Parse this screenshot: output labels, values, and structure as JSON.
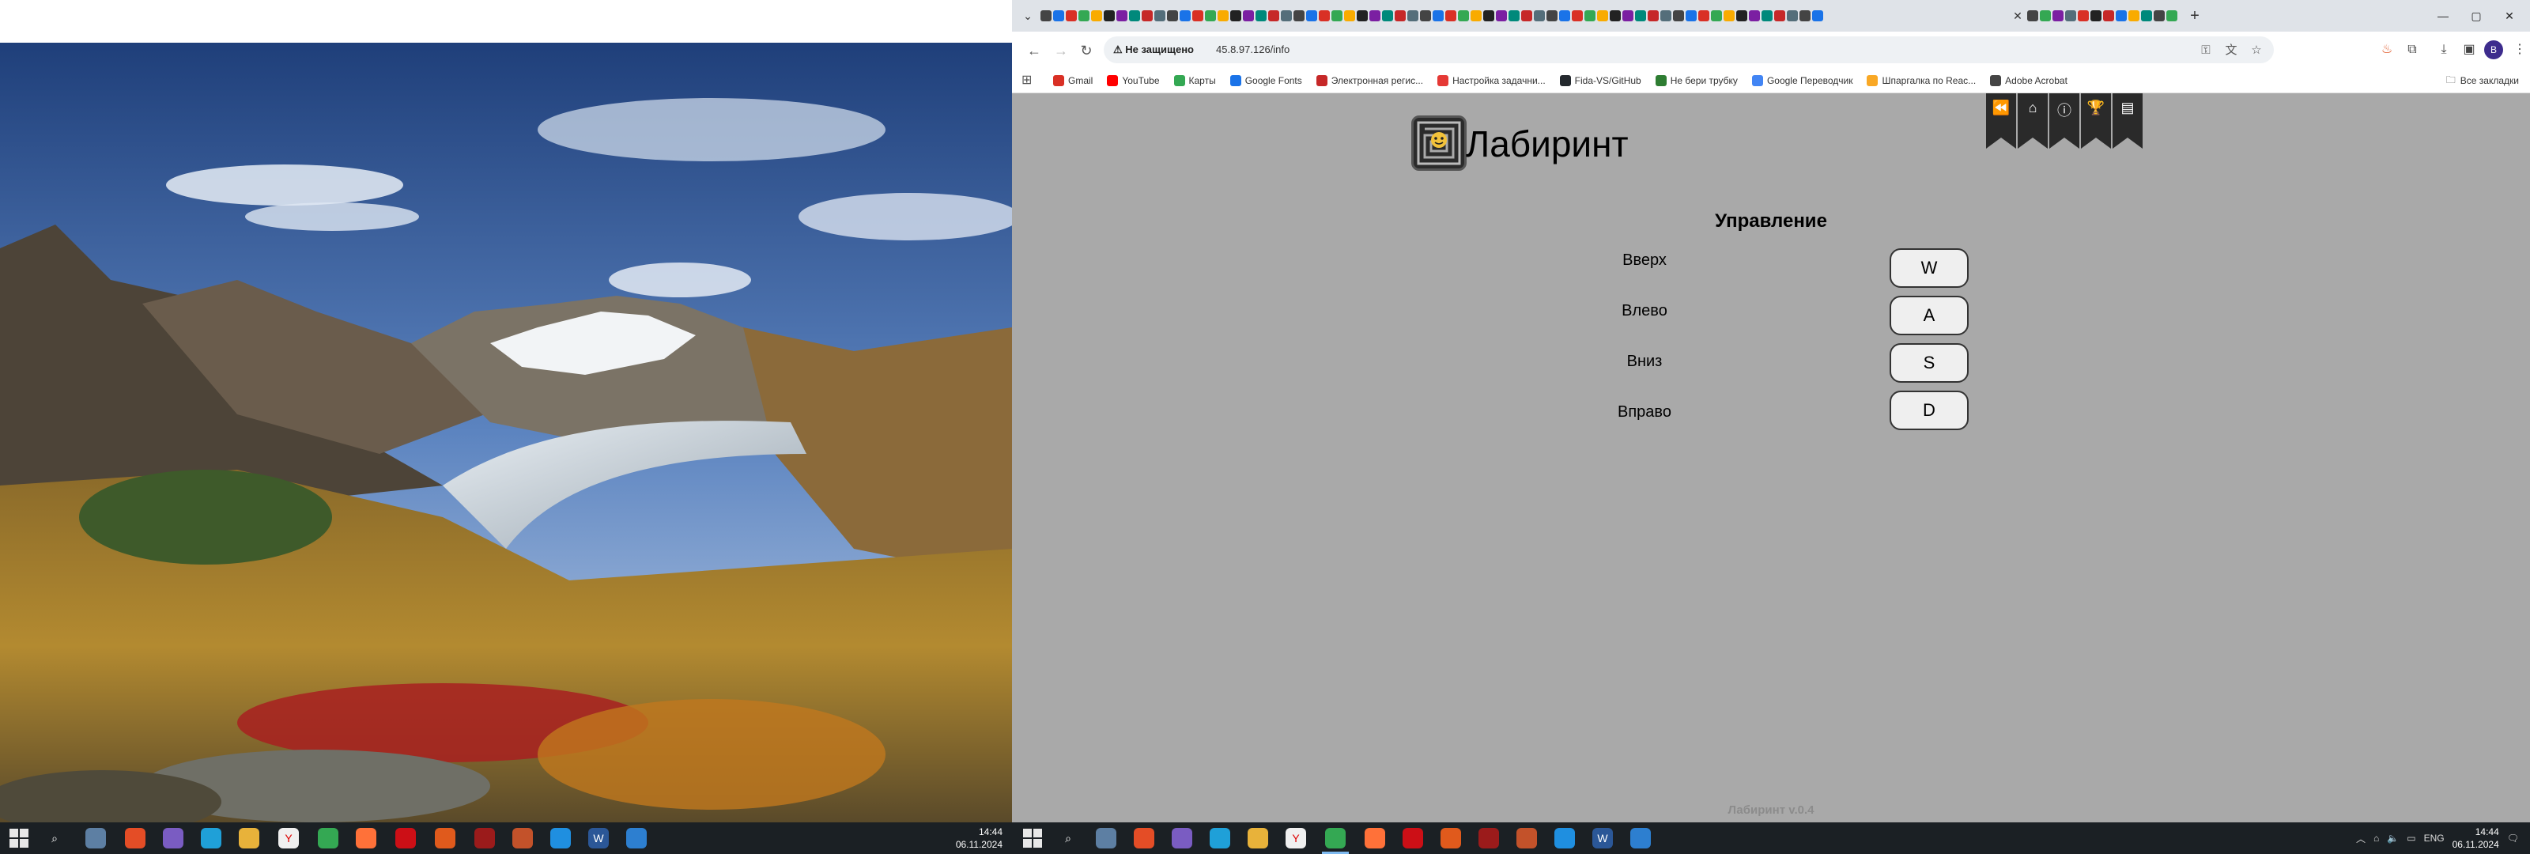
{
  "browser": {
    "tabs_active_close": "✕",
    "new_tab": "+",
    "window": {
      "minimize": "—",
      "maximize": "▢",
      "close": "✕"
    },
    "security_label": "Не защищено",
    "url": "45.8.97.126/info",
    "profile_initial": "В",
    "bookmarks": [
      {
        "label": "Gmail",
        "color": "#d93025"
      },
      {
        "label": "YouTube",
        "color": "#ff0000"
      },
      {
        "label": "Карты",
        "color": "#34a853"
      },
      {
        "label": "Google Fonts",
        "color": "#1a73e8"
      },
      {
        "label": "Электронная регис...",
        "color": "#c62828"
      },
      {
        "label": "Настройка задачни...",
        "color": "#e53935"
      },
      {
        "label": "Fida-VS/GitHub",
        "color": "#24292e"
      },
      {
        "label": "Не бери трубку",
        "color": "#2e7d32"
      },
      {
        "label": "Google Переводчик",
        "color": "#4285f4"
      },
      {
        "label": "Шпаргалка по Reac...",
        "color": "#f9a825"
      },
      {
        "label": "Adobe Acrobat",
        "color": "#444444"
      }
    ],
    "all_bookmarks": "Все закладки"
  },
  "site": {
    "title": "Лабиринт",
    "nav_icons": [
      "back-icon",
      "home-icon",
      "info-icon",
      "trophy-icon",
      "document-icon"
    ],
    "section_title": "Управление",
    "controls": [
      {
        "action": "Вверх",
        "key": "W"
      },
      {
        "action": "Влево",
        "key": "A"
      },
      {
        "action": "Вниз",
        "key": "S"
      },
      {
        "action": "Вправо",
        "key": "D"
      }
    ],
    "version": "Лабиринт v.0.4"
  },
  "taskbar_left": {
    "time": "14:44",
    "date": "06.11.2024"
  },
  "taskbar_right": {
    "time": "14:44",
    "date": "06.11.2024",
    "lang": "ENG"
  },
  "colors": {
    "page_bg": "#a9a9a9",
    "ribbon": "#2a2a2a",
    "taskbar": "#1b2024"
  }
}
